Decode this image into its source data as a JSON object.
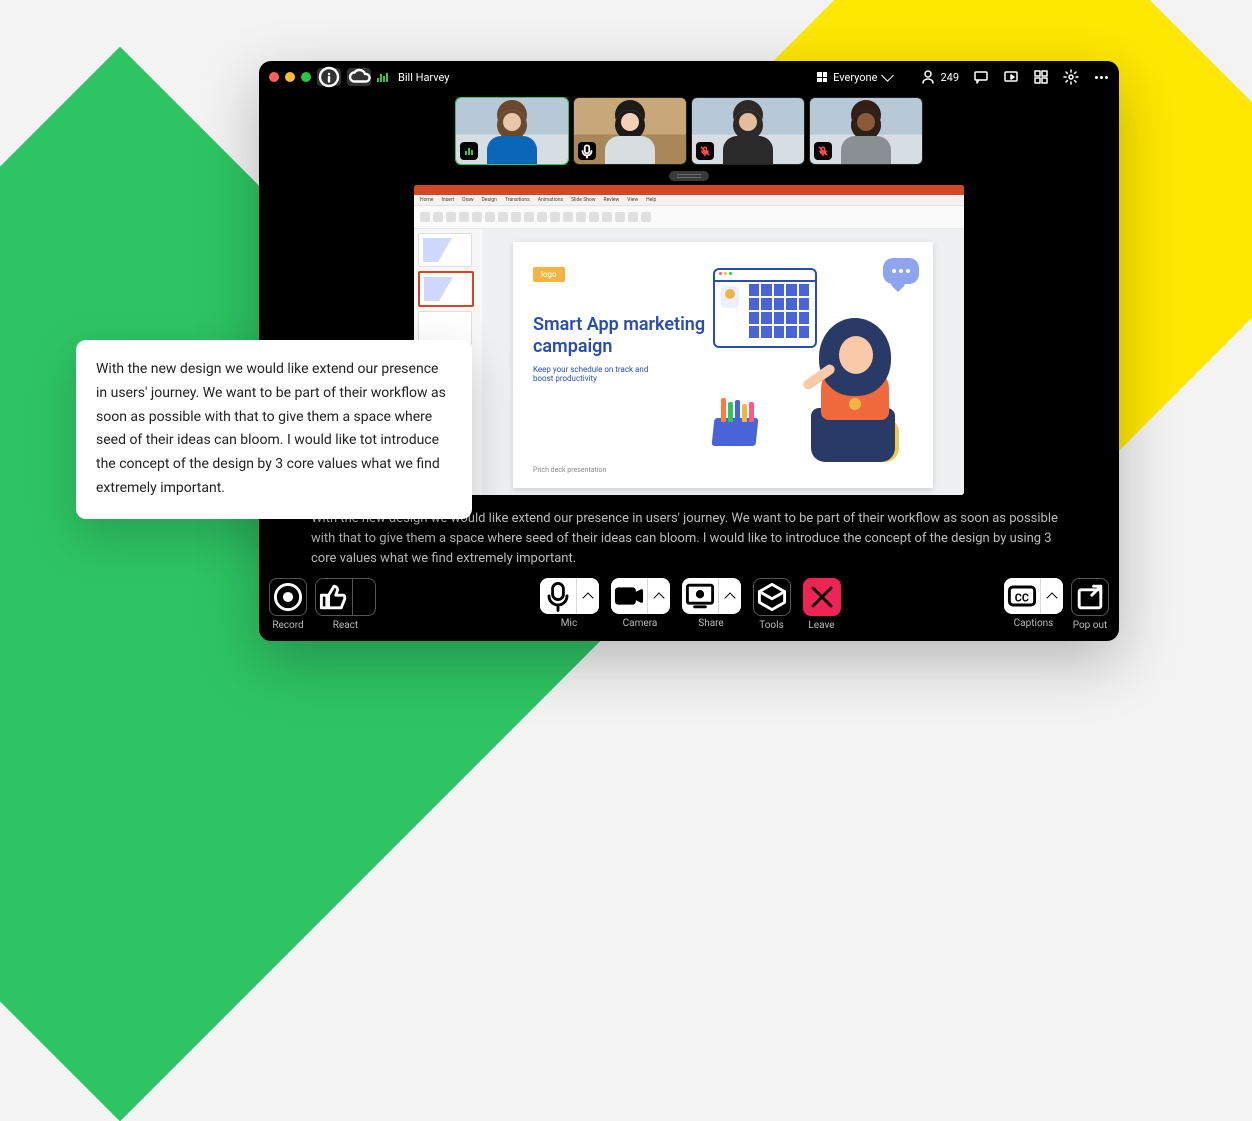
{
  "header": {
    "user": "Bill Harvey",
    "view_label": "Everyone",
    "participant_count": "249"
  },
  "participants": [
    {
      "skin": "#eac6a8",
      "hair": "#6a4a2e",
      "clothes": "#0a66b8",
      "background": "a",
      "speaking": true,
      "muted": false
    },
    {
      "skin": "#f2d1b6",
      "hair": "#1c1a1a",
      "clothes": "#d8dde0",
      "background": "b",
      "speaking": false,
      "muted": false
    },
    {
      "skin": "#e6bd9a",
      "hair": "#2c2a28",
      "clothes": "#2a2a2a",
      "background": "a",
      "speaking": false,
      "muted": true
    },
    {
      "skin": "#8a5a3a",
      "hair": "#2e1f17",
      "clothes": "#8a8f93",
      "background": "a",
      "speaking": false,
      "muted": true
    }
  ],
  "slide": {
    "logo": "logo",
    "title_line1": "Smart App marketing",
    "title_line2": "campaign",
    "subtitle": "Keep your schedule on track and boost productivity",
    "footer": "Pitch deck presentation"
  },
  "ppt_tabs": [
    "Home",
    "Insert",
    "Draw",
    "Design",
    "Transitions",
    "Animations",
    "Slide Show",
    "Review",
    "View",
    "Help"
  ],
  "caption_in_app": "With the new design we would like extend our presence in users' journey. We want to be part of their workflow as soon as possible with that to give them a space where seed of their ideas can bloom. I would like to introduce the concept of the design by using 3 core values what we find extremely important.",
  "overlay_text": "With the new design we would like extend our presence in users' journey. We want to be part of their workflow as soon as possible with that to give them a space where seed of their ideas can bloom. I would like tot introduce the concept of the design by 3 core values what we find extremely important.",
  "toolbar": {
    "record": "Record",
    "react": "React",
    "mic": "Mic",
    "camera": "Camera",
    "share": "Share",
    "tools": "Tools",
    "leave": "Leave",
    "captions": "Captions",
    "popout": "Pop out"
  }
}
